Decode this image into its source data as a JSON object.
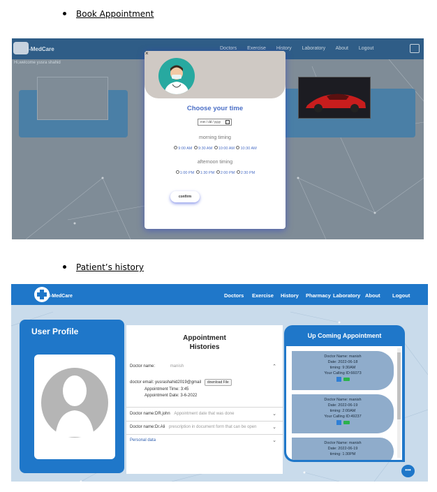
{
  "section1": {
    "heading": "Book Appointment"
  },
  "section2": {
    "heading": "Patient’s history"
  },
  "booking": {
    "logo_text": "I-MedCare",
    "nav": [
      "Doctors",
      "Exercise",
      "History",
      "Laboratory",
      "About",
      "Logout"
    ],
    "greeting": "Hi,welcome yusra shahid",
    "modal": {
      "close": "×",
      "title": "Choose your time",
      "date_placeholder": "mm / dd / yyyy",
      "morning_label": "morning timing",
      "morning_slots": [
        "9:00 AM",
        "9:30 AM",
        "10:00 AM",
        "10:30 AM"
      ],
      "afternoon_label": "afternoon timing",
      "afternoon_slots": [
        "1:00 PM",
        "1:30 PM",
        "2:00 PM",
        "2:30 PM"
      ],
      "confirm": "confirm"
    }
  },
  "history_page": {
    "logo_text": "I-MedCare",
    "nav": [
      "Doctors",
      "Exercise",
      "History",
      "Pharmacy",
      "Laboratory",
      "About",
      "Logout"
    ],
    "user_profile_title": "User Profile",
    "histories": {
      "title_line1": "Appointment",
      "title_line2": "Histories",
      "row1_label": "Doctor name:",
      "row1_value": "manish",
      "email_label": "doctor email:",
      "email_value": "yusrashahid2019@gmail",
      "download": "download File",
      "appt_time": "Appointment Time: 3:45",
      "appt_date": "Appointment Date: 3-6-2022",
      "row2_label": "Doctor name:DR.john",
      "row2_value": "Appointment date that was done",
      "row3_label": "Doctor name:Dr.Ali",
      "row3_value": "prescription in document form that can be open",
      "row4_label": "Personal data"
    },
    "upcoming": {
      "title": "Up Coming Appointment",
      "items": [
        {
          "name": "Doctor Name: manish",
          "date": "Date: 2022-06-18",
          "timing": "timing: 9:30AM",
          "calling": "Your Calling ID:66073"
        },
        {
          "name": "Doctor Name: manish",
          "date": "Date: 2022-06-19",
          "timing": "timing: 2:00AM",
          "calling": "Your Calling ID:49237"
        },
        {
          "name": "Doctor Name: manish",
          "date": "Date: 2022-06-19",
          "timing": "timing: 1:30PM",
          "calling": ""
        }
      ]
    },
    "chat_glyph": "•••"
  },
  "colors": {
    "nav_blue": "#1f77c9",
    "accent": "#4b6fc6"
  }
}
